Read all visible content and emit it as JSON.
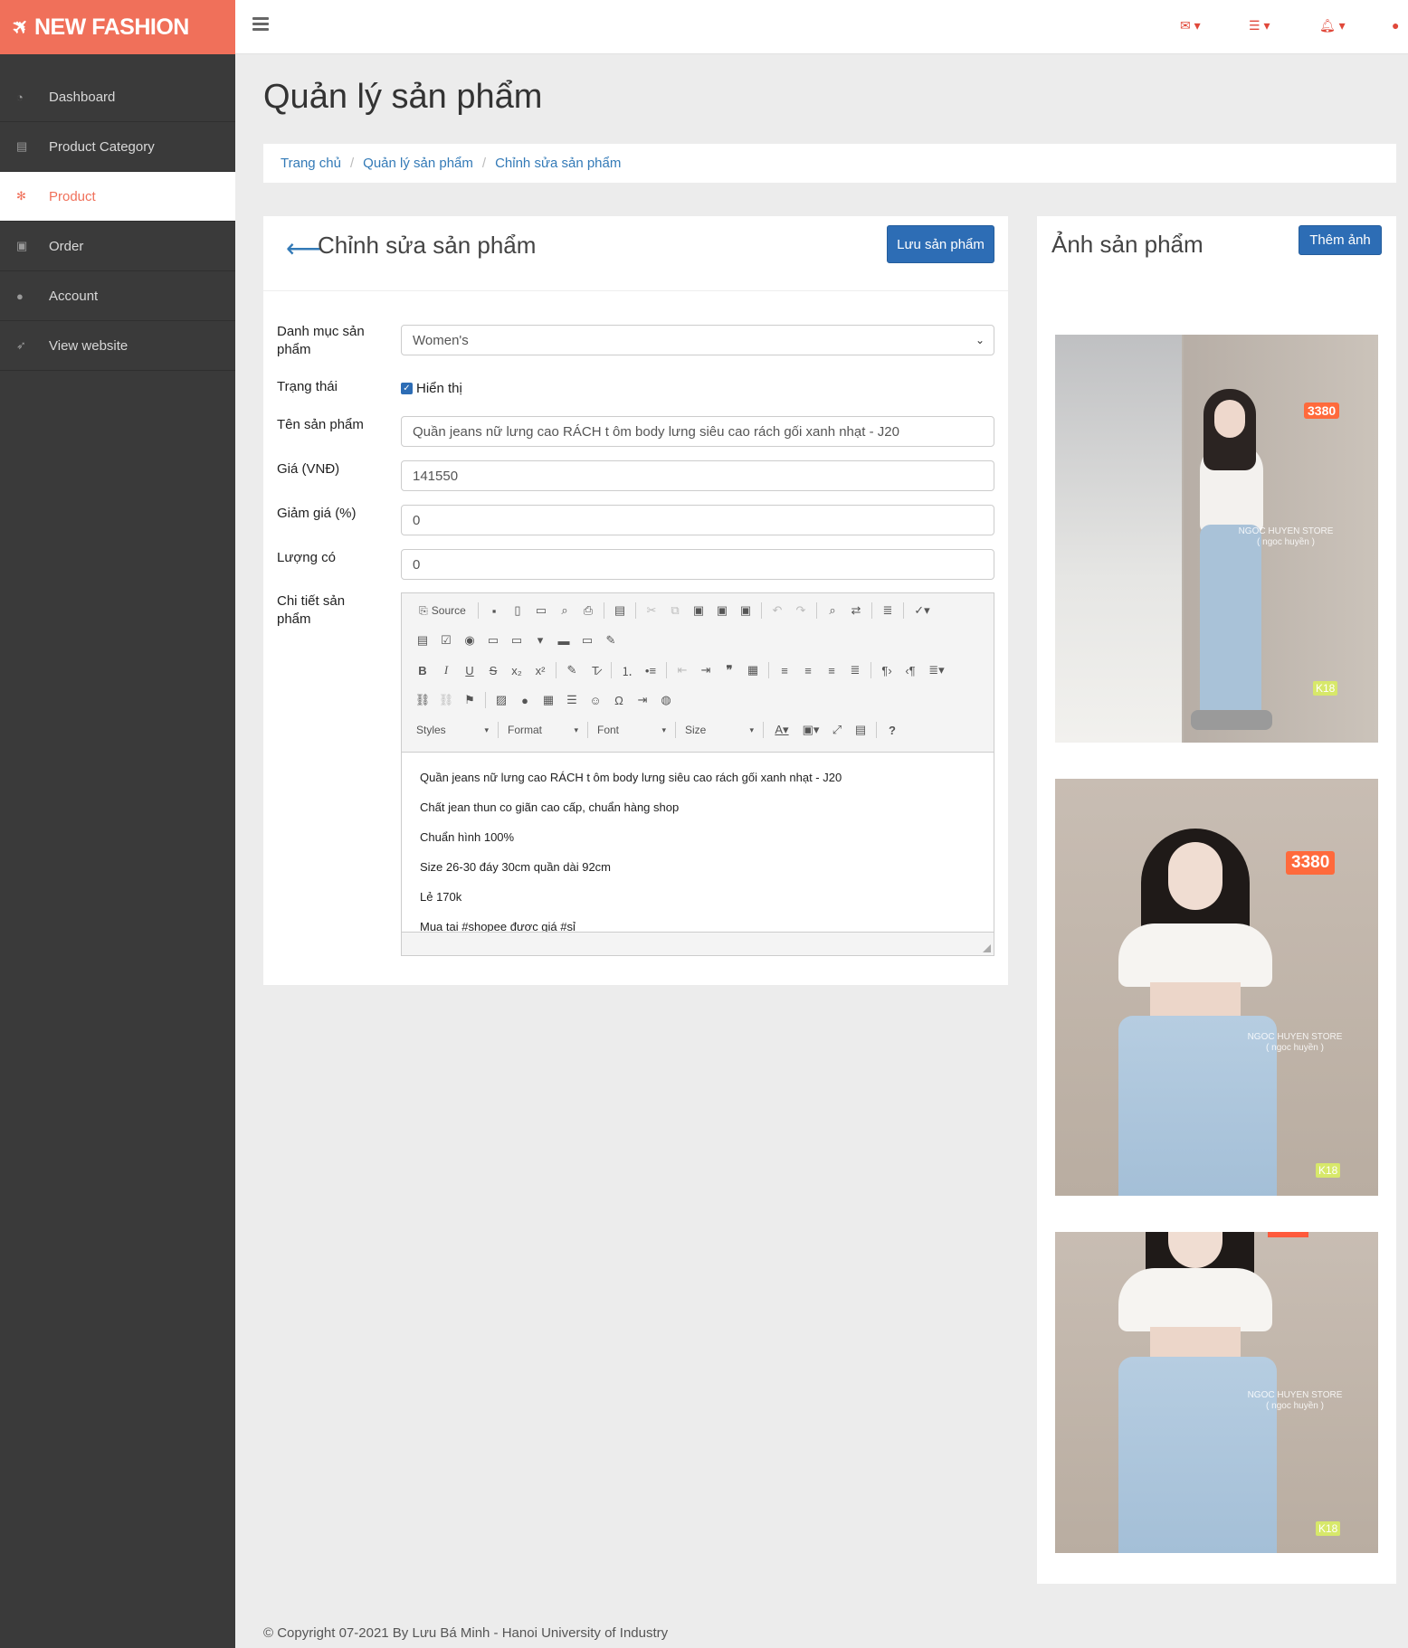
{
  "brand": {
    "name": "NEW FASHION"
  },
  "sidebar": {
    "items": [
      {
        "label": "Dashboard",
        "icon": "dashboard-icon"
      },
      {
        "label": "Product Category",
        "icon": "book-icon"
      },
      {
        "label": "Product",
        "icon": "asterisk-icon",
        "active": true
      },
      {
        "label": "Order",
        "icon": "money-icon"
      },
      {
        "label": "Account",
        "icon": "user-icon"
      },
      {
        "label": "View website",
        "icon": "rocket-icon"
      }
    ]
  },
  "topbar": {
    "icons": [
      "envelope-icon",
      "tasks-icon",
      "bell-icon",
      "user-icon"
    ]
  },
  "page": {
    "title": "Quản lý sản phẩm",
    "breadcrumb": [
      "Trang chủ",
      "Quản lý sản phẩm",
      "Chỉnh sửa sản phẩm"
    ]
  },
  "form": {
    "title": "Chỉnh sửa sản phẩm",
    "save_label": "Lưu sản phẩm",
    "category_label": "Danh mục sản phẩm",
    "category_value": "Women's",
    "status_label": "Trạng thái",
    "status_checkbox_label": "Hiển thị",
    "status_checked": true,
    "name_label": "Tên sản phẩm",
    "name_value": "Quần jeans nữ lưng cao RÁCH t ôm body lưng siêu cao rách gối xanh nhạt - J20",
    "price_label": "Giá (VNĐ)",
    "price_value": "141550",
    "discount_label": "Giảm giá (%)",
    "discount_value": "0",
    "quantity_label": "Lượng có",
    "quantity_value": "0",
    "detail_label": "Chi tiết sản phẩm"
  },
  "editor": {
    "source_label": "Source",
    "styles_label": "Styles",
    "format_label": "Format",
    "font_label": "Font",
    "size_label": "Size",
    "content": [
      "Quần jeans nữ lưng cao RÁCH t ôm body lưng siêu cao rách gối xanh nhạt - J20",
      "Chất jean thun co giãn cao cấp, chuẩn hàng shop",
      "Chuẩn hình 100%",
      "Size 26-30 đáy 30cm quần dài 92cm",
      "Lẻ 170k",
      "Mua tại #shopee được giá #sỉ"
    ]
  },
  "images_panel": {
    "title": "Ảnh sản phẩm",
    "add_label": "Thêm ảnh",
    "photo_tag": "3380",
    "photo_watermark": "NGOC HUYEN STORE",
    "photo_watermark_sub": "( ngoc huyền )",
    "photo_badge": "K18"
  },
  "footer": {
    "text": "© Copyright 07-2021 By Lưu Bá Minh - Hanoi University of Industry"
  },
  "colors": {
    "brand": "#f0705a",
    "primary": "#2d6db5",
    "sidebar": "#3a3a3a"
  }
}
